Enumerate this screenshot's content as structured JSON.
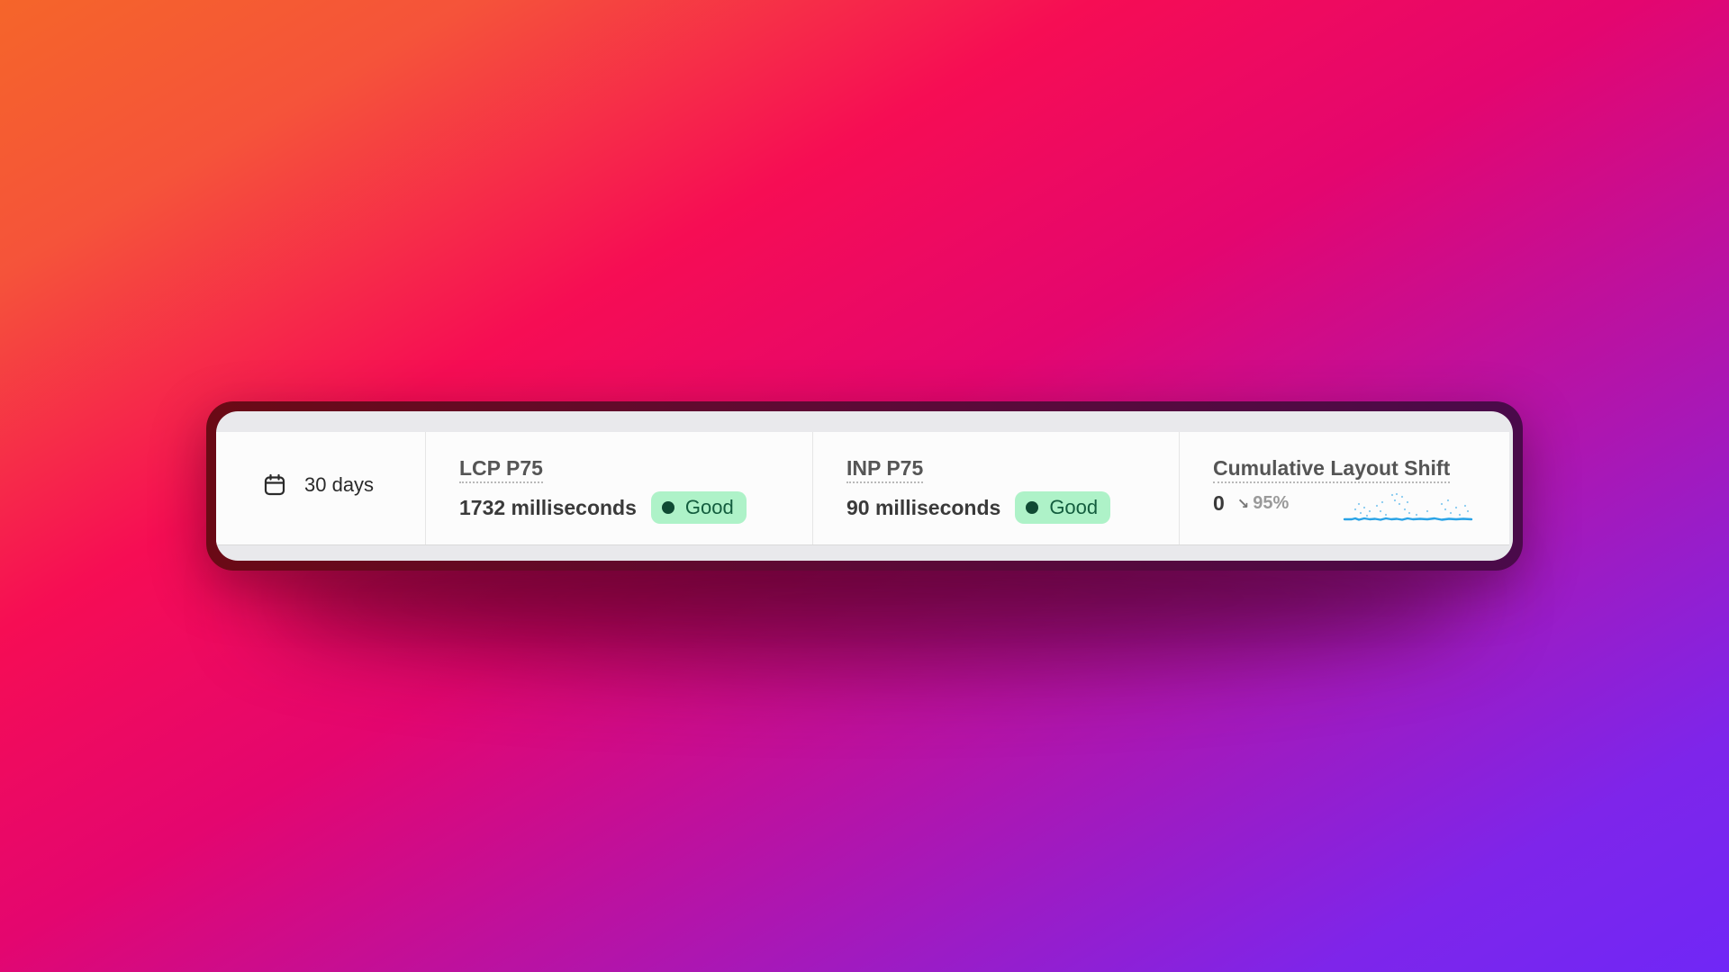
{
  "date_range": {
    "icon": "calendar-icon",
    "label": "30 days"
  },
  "metrics": [
    {
      "title": "LCP P75",
      "value": "1732 milliseconds",
      "status": "Good",
      "status_color": "#aef2c8"
    },
    {
      "title": "INP P75",
      "value": "90 milliseconds",
      "status": "Good",
      "status_color": "#aef2c8"
    },
    {
      "title": "Cumulative Layout Shift",
      "value": "0",
      "delta": {
        "direction": "down",
        "icon": "arrow-down-right-icon",
        "value": "95%"
      },
      "sparkline_color": "#2aa3e6"
    }
  ],
  "colors": {
    "good_badge_bg": "#aef2c8",
    "good_badge_dot": "#0f4a33",
    "sparkline": "#2aa3e6"
  }
}
